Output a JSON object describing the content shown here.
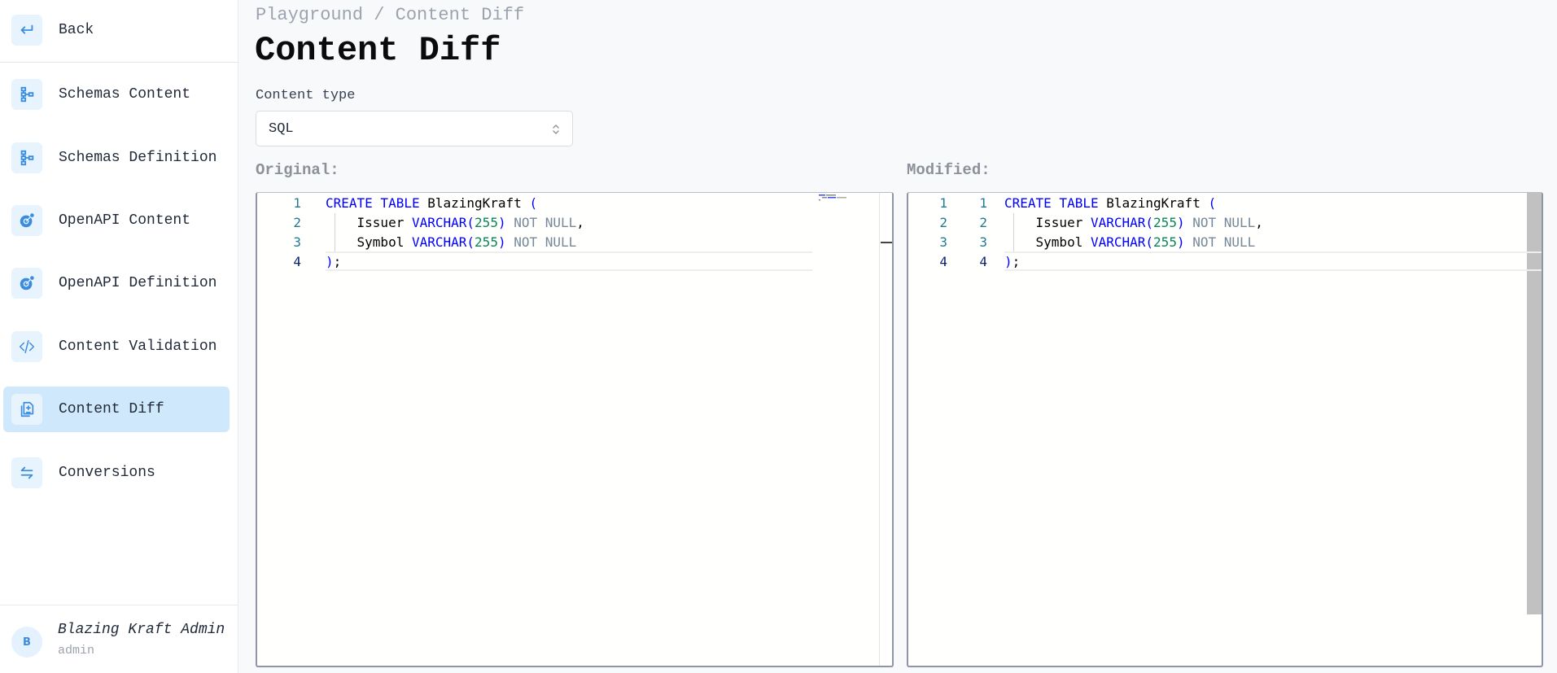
{
  "sidebar": {
    "back": {
      "label": "Back",
      "icon": "arrow-return-left-icon"
    },
    "items": [
      {
        "label": "Schemas Content",
        "icon": "schema-tree-icon",
        "active": false
      },
      {
        "label": "Schemas Definition",
        "icon": "schema-tree-icon",
        "active": false
      },
      {
        "label": "OpenAPI Content",
        "icon": "openapi-icon",
        "active": false
      },
      {
        "label": "OpenAPI Definition",
        "icon": "openapi-icon",
        "active": false
      },
      {
        "label": "Content Validation",
        "icon": "code-brackets-icon",
        "active": false
      },
      {
        "label": "Content Diff",
        "icon": "file-diff-icon",
        "active": true
      },
      {
        "label": "Conversions",
        "icon": "swap-arrows-icon",
        "active": false
      }
    ],
    "user": {
      "avatar_initial": "B",
      "name": "Blazing Kraft Admin",
      "role": "admin"
    }
  },
  "header": {
    "breadcrumb": "Playground / Content Diff",
    "title": "Content Diff"
  },
  "content_type": {
    "label": "Content type",
    "selected": "SQL"
  },
  "original": {
    "label": "Original:",
    "lines": [
      {
        "n": "1",
        "tokens": [
          [
            "kw",
            "CREATE TABLE"
          ],
          [
            "txt",
            " BlazingKraft "
          ],
          [
            "kw",
            "("
          ]
        ]
      },
      {
        "n": "2",
        "tokens": [
          [
            "txt",
            "    Issuer "
          ],
          [
            "kw",
            "VARCHAR"
          ],
          [
            "kw",
            "("
          ],
          [
            "num",
            "255"
          ],
          [
            "kw",
            ")"
          ],
          [
            "op",
            " NOT NULL"
          ],
          [
            "txt",
            ","
          ]
        ]
      },
      {
        "n": "3",
        "tokens": [
          [
            "txt",
            "    Symbol "
          ],
          [
            "kw",
            "VARCHAR"
          ],
          [
            "kw",
            "("
          ],
          [
            "num",
            "255"
          ],
          [
            "kw",
            ")"
          ],
          [
            "op",
            " NOT NULL"
          ]
        ]
      },
      {
        "n": "4",
        "tokens": [
          [
            "kw",
            ")"
          ],
          [
            "txt",
            ";"
          ]
        ]
      }
    ]
  },
  "modified": {
    "label": "Modified:",
    "lines": [
      {
        "n_orig": "1",
        "n": "1",
        "tokens": [
          [
            "kw",
            "CREATE TABLE"
          ],
          [
            "txt",
            " BlazingKraft "
          ],
          [
            "kw",
            "("
          ]
        ]
      },
      {
        "n_orig": "2",
        "n": "2",
        "tokens": [
          [
            "txt",
            "    Issuer "
          ],
          [
            "kw",
            "VARCHAR"
          ],
          [
            "kw",
            "("
          ],
          [
            "num",
            "255"
          ],
          [
            "kw",
            ")"
          ],
          [
            "op",
            " NOT NULL"
          ],
          [
            "txt",
            ","
          ]
        ]
      },
      {
        "n_orig": "3",
        "n": "3",
        "tokens": [
          [
            "txt",
            "    Symbol "
          ],
          [
            "kw",
            "VARCHAR"
          ],
          [
            "kw",
            "("
          ],
          [
            "num",
            "255"
          ],
          [
            "kw",
            ")"
          ],
          [
            "op",
            " NOT NULL"
          ]
        ]
      },
      {
        "n_orig": "4",
        "n": "4",
        "tokens": [
          [
            "kw",
            ")"
          ],
          [
            "txt",
            ";"
          ]
        ]
      }
    ]
  },
  "colors": {
    "accent": "#3b8cdf",
    "active_nav_bg": "#d0e8fb",
    "keyword": "#0000ff",
    "number": "#098658",
    "line_number": "#237893"
  }
}
